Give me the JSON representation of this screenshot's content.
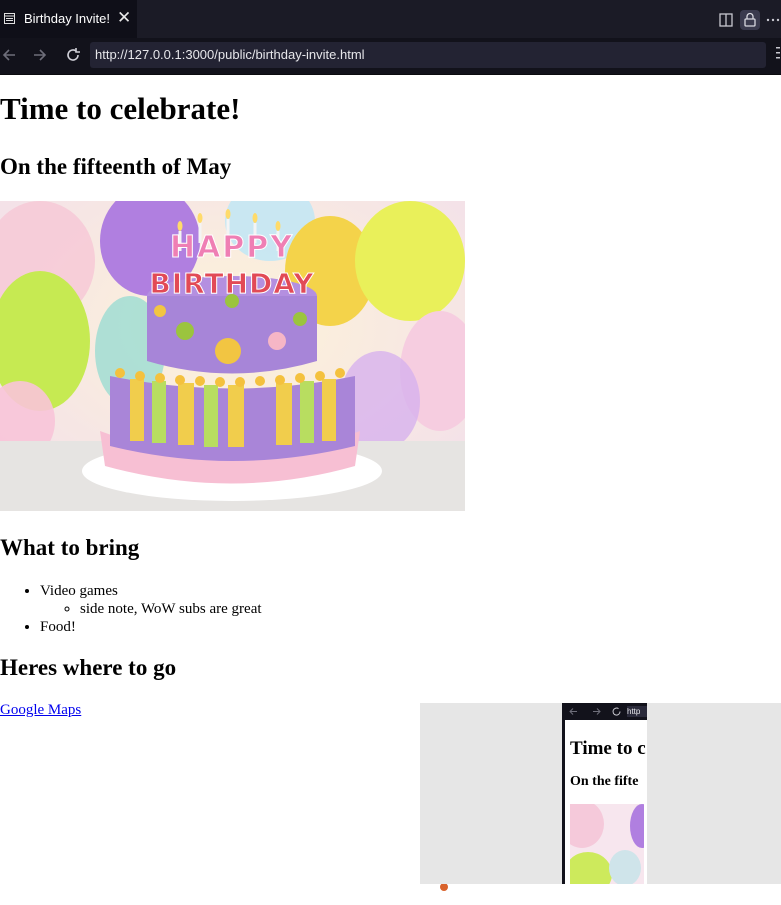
{
  "browser": {
    "tab_title": "Birthday Invite!",
    "tab_close": "✕",
    "url": "http://127.0.0.1:3000/public/birthday-invite.html",
    "icons": [
      "page-icon",
      "split-view-icon",
      "lock-icon",
      "more-icon",
      "back-icon",
      "forward-icon",
      "reload-icon",
      "menu-icon"
    ]
  },
  "page": {
    "heading": "Time to celebrate!",
    "date": "On the fifteenth of May",
    "image": {
      "alt": "birthday cake",
      "cake_text_1": "HAPPY",
      "cake_text_2": "BIRTHDAY"
    },
    "bring_heading": "What to bring",
    "bring_items": [
      {
        "label": "Video games",
        "sub": [
          "side note, WoW subs are great"
        ]
      },
      {
        "label": "Food!"
      }
    ],
    "where_heading": "Heres where to go",
    "map_link": "Google Maps"
  },
  "preview": {
    "url": "http",
    "heading": "Time to c",
    "date": "On the fifte"
  },
  "colors": {
    "chrome": "#1b1b26",
    "url_bar": "#232333",
    "link": "#0000ee"
  }
}
